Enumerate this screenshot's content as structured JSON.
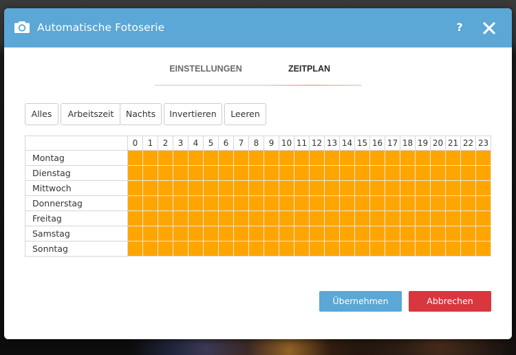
{
  "colors": {
    "header": "#5ba7d6",
    "slot_active": "#ffa500",
    "primary": "#5ba7d6",
    "danger": "#d9363e"
  },
  "dialog": {
    "title": "Automatische Fotoserie",
    "icon": "camera-icon",
    "help_label": "?",
    "close_icon": "close-icon"
  },
  "tabs": [
    {
      "label": "EINSTELLUNGEN",
      "active": false
    },
    {
      "label": "ZEITPLAN",
      "active": true
    }
  ],
  "presets": [
    {
      "label": "Alles"
    },
    {
      "label": "Arbeitszeit"
    },
    {
      "label": "Nachts"
    },
    {
      "label": "Invertieren"
    },
    {
      "label": "Leeren"
    }
  ],
  "schedule": {
    "hours": [
      "0",
      "1",
      "2",
      "3",
      "4",
      "5",
      "6",
      "7",
      "8",
      "9",
      "10",
      "11",
      "12",
      "13",
      "14",
      "15",
      "16",
      "17",
      "18",
      "19",
      "20",
      "21",
      "22",
      "23"
    ],
    "days": [
      {
        "name": "Montag",
        "active_hours": [
          0,
          1,
          2,
          3,
          4,
          5,
          6,
          7,
          8,
          9,
          10,
          11,
          12,
          13,
          14,
          15,
          16,
          17,
          18,
          19,
          20,
          21,
          22,
          23
        ]
      },
      {
        "name": "Dienstag",
        "active_hours": [
          0,
          1,
          2,
          3,
          4,
          5,
          6,
          7,
          8,
          9,
          10,
          11,
          12,
          13,
          14,
          15,
          16,
          17,
          18,
          19,
          20,
          21,
          22,
          23
        ]
      },
      {
        "name": "Mittwoch",
        "active_hours": [
          0,
          1,
          2,
          3,
          4,
          5,
          6,
          7,
          8,
          9,
          10,
          11,
          12,
          13,
          14,
          15,
          16,
          17,
          18,
          19,
          20,
          21,
          22,
          23
        ]
      },
      {
        "name": "Donnerstag",
        "active_hours": [
          0,
          1,
          2,
          3,
          4,
          5,
          6,
          7,
          8,
          9,
          10,
          11,
          12,
          13,
          14,
          15,
          16,
          17,
          18,
          19,
          20,
          21,
          22,
          23
        ]
      },
      {
        "name": "Freitag",
        "active_hours": [
          0,
          1,
          2,
          3,
          4,
          5,
          6,
          7,
          8,
          9,
          10,
          11,
          12,
          13,
          14,
          15,
          16,
          17,
          18,
          19,
          20,
          21,
          22,
          23
        ]
      },
      {
        "name": "Samstag",
        "active_hours": [
          0,
          1,
          2,
          3,
          4,
          5,
          6,
          7,
          8,
          9,
          10,
          11,
          12,
          13,
          14,
          15,
          16,
          17,
          18,
          19,
          20,
          21,
          22,
          23
        ]
      },
      {
        "name": "Sonntag",
        "active_hours": [
          0,
          1,
          2,
          3,
          4,
          5,
          6,
          7,
          8,
          9,
          10,
          11,
          12,
          13,
          14,
          15,
          16,
          17,
          18,
          19,
          20,
          21,
          22,
          23
        ]
      }
    ]
  },
  "actions": {
    "apply_label": "Übernehmen",
    "cancel_label": "Abbrechen"
  }
}
